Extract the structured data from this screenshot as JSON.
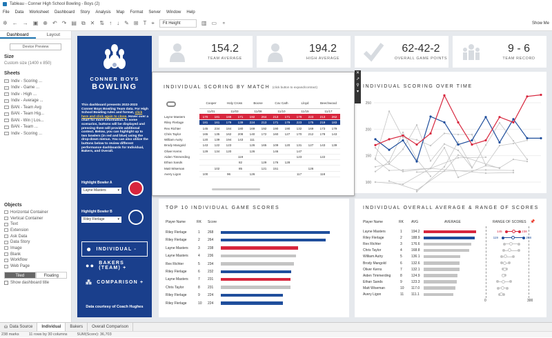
{
  "window": {
    "title": "Tableau - Conner High School Bowling - Boys (2)"
  },
  "menu": [
    "File",
    "Data",
    "Worksheet",
    "Dashboard",
    "Story",
    "Analysis",
    "Map",
    "Format",
    "Server",
    "Window",
    "Help"
  ],
  "toolbar": {
    "fit": "Fit Height",
    "show_me": "Show Me"
  },
  "left": {
    "tabs": [
      "Dashboard",
      "Layout"
    ],
    "device_preview": "Device Preview",
    "size_h": "Size",
    "size_value": "Custom size (1400 x 850)",
    "sheets_h": "Sheets",
    "sheets": [
      "Indiv - Scoring ...",
      "Indiv - Game ...",
      "Indiv - High ...",
      "Indiv - Average ...",
      "BAN - Team Avg",
      "BAN - Team Hig...",
      "BAN - Win | Los...",
      "BAN - Team ...",
      "Indiv - Scoring ..."
    ],
    "objects_h": "Objects",
    "objects": [
      "Horizontal Container",
      "Vertical Container",
      "Text",
      "Extension",
      "Ask Data",
      "Data Story",
      "Image",
      "Blank",
      "Workflow",
      "Web Page"
    ],
    "tiled": "Tiled",
    "floating": "Floating",
    "show_title": "Show dashboard title"
  },
  "panel": {
    "title1": "CONNER BOYS",
    "title2": "BOWLING",
    "intro_a": "This dashboard presents 2022-2023 Conner Boys Bowling Team data. For High School Bowling rules and format, ",
    "intro_link": "click here and click again to close",
    "intro_b": ". Hover over a chart for more information. In some scenarios, buttons will be displayed and pressing them will provide additional context. Below, you can highlight up to two bowlers (in red and blue) using the drop-down menus. You can also utilize the buttons below to review different performance dashboards for Individual, Bakers, and Overall.",
    "hlA_label": "Highlight Bowler A",
    "hlA_value": "Layne Masters",
    "hlB_label": "Highlight Bowler B",
    "hlB_value": "Riley Flerlage",
    "btn_individual": "INDIVIDUAL -",
    "btn_bakers": "BAKERS (TEAM) +",
    "btn_comparison": "COMPARISON +",
    "courtesy": "Data courtesy of Coach Hughes"
  },
  "kpis": [
    {
      "value": "154.2",
      "label": "TEAM AVERAGE",
      "icon": "person-icon"
    },
    {
      "value": "194.2",
      "label": "HIGH AVERAGE",
      "icon": "person-icon"
    },
    {
      "value": "62-42-2",
      "label": "OVERALL GAME POINTS",
      "icon": "check-icon"
    },
    {
      "value": "9 - 6",
      "label": "TEAM RECORD",
      "icon": "team-icon"
    }
  ],
  "scoring": {
    "title": "INDIVIDUAL SCORING BY MATCH",
    "subtitle": "(click button to expand/contract)",
    "opponents": [
      "Cooper",
      "Holy Cross",
      "Boone",
      "Cov Cath",
      "Lloyd",
      "Beechwood"
    ],
    "dates": [
      "11/01",
      "11/03",
      "11/08",
      "11/10",
      "11/15",
      "11/17"
    ],
    "rows": [
      {
        "name": "Layne Masters",
        "hl": 1,
        "v": [
          "170",
          "181",
          "188",
          "171",
          "192",
          "264",
          "213",
          "171",
          "179",
          "223",
          "213",
          "262",
          "265"
        ]
      },
      {
        "name": "Riley Flerlage",
        "hl": 2,
        "v": [
          "181",
          "161",
          "179",
          "139",
          "224",
          "213",
          "171",
          "179",
          "223",
          "175",
          "219",
          "183",
          "183"
        ]
      },
      {
        "name": "Rex Richter",
        "hl": 0,
        "v": [
          "145",
          "234",
          "184",
          "180",
          "169",
          "192",
          "190",
          "190",
          "132",
          "169",
          "173",
          "179",
          ""
        ]
      },
      {
        "name": "Chris Taylor",
        "hl": 0,
        "v": [
          "165",
          "135",
          "162",
          "208",
          "140",
          "172",
          "160",
          "127",
          "170",
          "212",
          "178",
          "143",
          ""
        ]
      },
      {
        "name": "William Autry",
        "hl": 0,
        "v": [
          "120",
          "139",
          "194",
          "143",
          "111",
          "",
          "",
          "",
          "",
          "",
          "",
          "",
          ""
        ]
      },
      {
        "name": "Brody Mangold",
        "hl": 0,
        "v": [
          "143",
          "122",
          "123",
          "",
          "126",
          "165",
          "109",
          "120",
          "131",
          "127",
          "143",
          "139",
          ""
        ]
      },
      {
        "name": "Oliver Kerns",
        "hl": 0,
        "v": [
          "129",
          "134",
          "120",
          "",
          "126",
          "",
          "146",
          "",
          "147",
          "",
          "",
          "",
          ""
        ]
      },
      {
        "name": "Aiden Timmerding",
        "hl": 0,
        "v": [
          "",
          "",
          "",
          "119",
          "",
          "",
          "",
          "",
          "123",
          "",
          "122",
          "",
          ""
        ]
      },
      {
        "name": "Ethan Sands",
        "hl": 0,
        "v": [
          "",
          "",
          "",
          "82",
          "",
          "129",
          "176",
          "128",
          "",
          "",
          "",
          "",
          ""
        ]
      },
      {
        "name": "Matt Wiseman",
        "hl": 0,
        "v": [
          "",
          "102",
          "",
          "85",
          "",
          "121",
          "151",
          "",
          "",
          "126",
          "",
          "",
          ""
        ]
      },
      {
        "name": "Avery Ligon",
        "hl": 0,
        "v": [
          "100",
          "",
          "96",
          "",
          "126",
          "",
          "",
          "",
          "117",
          "",
          "118",
          "",
          ""
        ]
      }
    ]
  },
  "over_time": {
    "title": "INDIVIDUAL SCORING OVER TIME",
    "y_ticks": [
      "250",
      "200",
      "150",
      "100"
    ]
  },
  "top10": {
    "title": "TOP 10 INDIVIDUAL GAME SCORES",
    "headers": [
      "Player Name",
      "RK",
      "Score"
    ],
    "rows": [
      {
        "name": "Riley Flerlage",
        "rk": "1",
        "score": "268",
        "c": "blue"
      },
      {
        "name": "Riley Flerlage",
        "rk": "2",
        "score": "264",
        "c": "blue"
      },
      {
        "name": "Layne Masters",
        "rk": "3",
        "score": "238",
        "c": "red"
      },
      {
        "name": "Layne Masters",
        "rk": "4",
        "score": "236",
        "c": "gray"
      },
      {
        "name": "Rex Richter",
        "rk": "5",
        "score": "234",
        "c": "gray"
      },
      {
        "name": "Riley Flerlage",
        "rk": "6",
        "score": "232",
        "c": "blue"
      },
      {
        "name": "Layne Masters",
        "rk": "7",
        "score": "231",
        "c": "red"
      },
      {
        "name": "Chris Taylor",
        "rk": "8",
        "score": "231",
        "c": "gray"
      },
      {
        "name": "Riley Flerlage",
        "rk": "9",
        "score": "224",
        "c": "blue"
      },
      {
        "name": "Riley Flerlage",
        "rk": "10",
        "score": "224",
        "c": "blue"
      }
    ]
  },
  "overall": {
    "title": "INDIVIDUAL OVERALL AVERAGE & RANGE OF SCORES",
    "headers": [
      "Player Name",
      "RK",
      "AVG",
      "AVERAGE",
      "RANGE OF SCORES"
    ],
    "axis": [
      "0",
      "300"
    ],
    "rows": [
      {
        "name": "Layne Masters",
        "rk": "1",
        "avg": "194.2",
        "val": 194.2,
        "min": 145,
        "max": 238,
        "c": "red",
        "lmin": "145",
        "lmax": "238"
      },
      {
        "name": "Riley Flerlage",
        "rk": "2",
        "avg": "188.9",
        "val": 188.9,
        "min": 119,
        "max": 268,
        "c": "blue",
        "lmin": "119",
        "lmax": "268"
      },
      {
        "name": "Rex Richter",
        "rk": "3",
        "avg": "176.6",
        "val": 176.6,
        "min": 132,
        "max": 234,
        "c": "gray",
        "lmin": "",
        "lmax": ""
      },
      {
        "name": "Chris Taylor",
        "rk": "4",
        "avg": "168.8",
        "val": 168.8,
        "min": 127,
        "max": 231,
        "c": "gray",
        "lmin": "",
        "lmax": ""
      },
      {
        "name": "William Autry",
        "rk": "5",
        "avg": "136.1",
        "val": 136.1,
        "min": 111,
        "max": 194,
        "c": "gray",
        "lmin": "",
        "lmax": ""
      },
      {
        "name": "Brody Mangold",
        "rk": "6",
        "avg": "132.6",
        "val": 132.6,
        "min": 109,
        "max": 165,
        "c": "gray",
        "lmin": "",
        "lmax": ""
      },
      {
        "name": "Oliver Kerns",
        "rk": "7",
        "avg": "132.1",
        "val": 132.1,
        "min": 120,
        "max": 147,
        "c": "gray",
        "lmin": "",
        "lmax": ""
      },
      {
        "name": "Aiden Timmerding",
        "rk": "8",
        "avg": "124.9",
        "val": 124.9,
        "min": 119,
        "max": 135,
        "c": "gray",
        "lmin": "",
        "lmax": ""
      },
      {
        "name": "Ethan Sands",
        "rk": "9",
        "avg": "123.3",
        "val": 123.3,
        "min": 82,
        "max": 176,
        "c": "gray",
        "lmin": "",
        "lmax": ""
      },
      {
        "name": "Matt Wiseman",
        "rk": "10",
        "avg": "117.0",
        "val": 117.0,
        "min": 85,
        "max": 151,
        "c": "gray",
        "lmin": "",
        "lmax": ""
      },
      {
        "name": "Avery Ligon",
        "rk": "11",
        "avg": "111.1",
        "val": 111.1,
        "min": 96,
        "max": 126,
        "c": "gray",
        "lmin": "",
        "lmax": ""
      }
    ]
  },
  "tabs": [
    "Data Source",
    "Individual",
    "Bakers",
    "Overall Comparison"
  ],
  "status": [
    "238 marks",
    "11 rows by 30 columns",
    "SUM(Score): 36,703"
  ],
  "colors": {
    "navy": "#1a3f8c",
    "red": "#d7263d",
    "blue": "#1f4e9c",
    "gray": "#c4c4c4"
  }
}
